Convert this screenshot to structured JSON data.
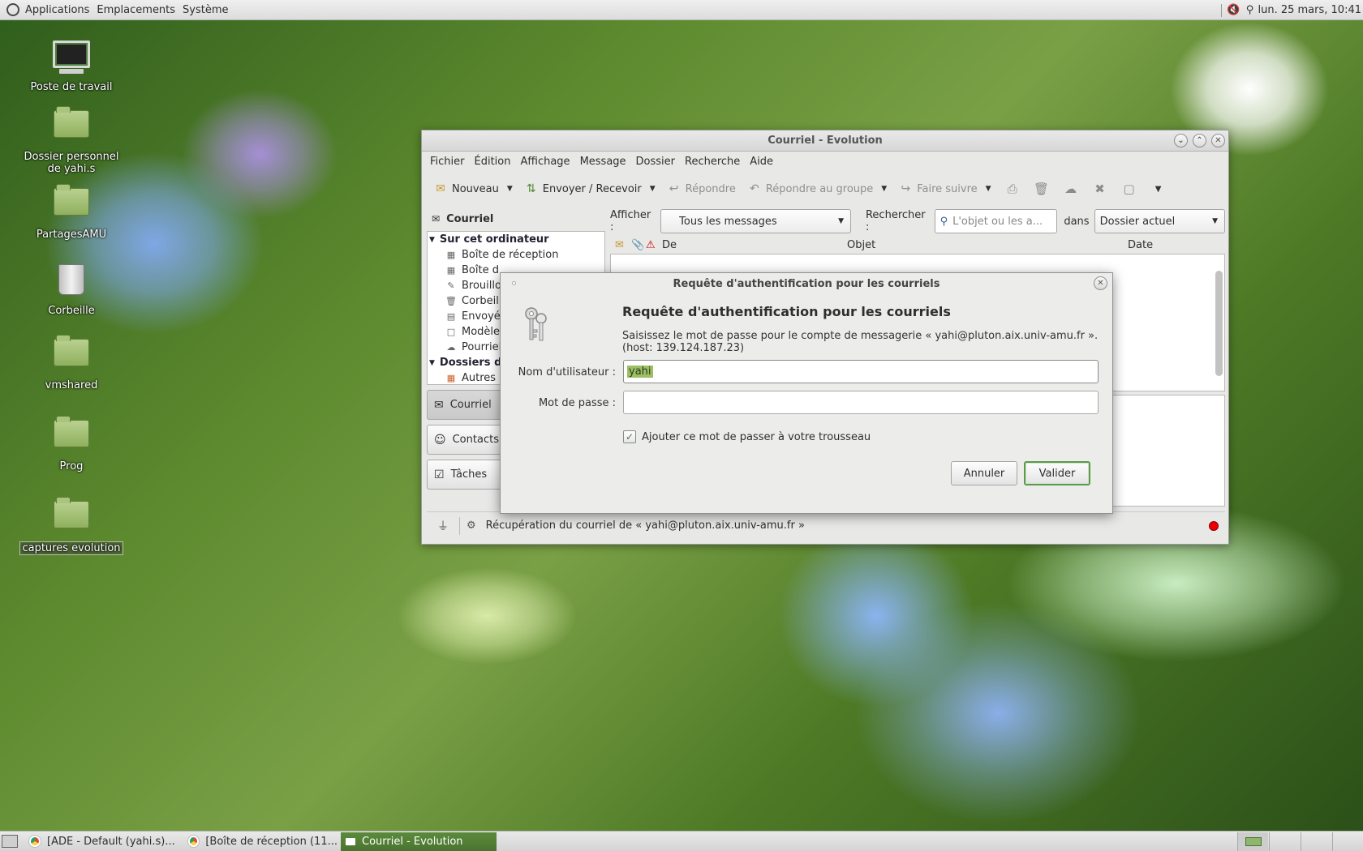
{
  "top_panel": {
    "menus": [
      "Applications",
      "Emplacements",
      "Système"
    ],
    "clock": "lun. 25 mars, 10:41"
  },
  "desktop_icons": [
    {
      "label": "Poste de travail",
      "icon": "computer-icon"
    },
    {
      "label": "Dossier personnel de yahi.s",
      "icon": "home-folder-icon"
    },
    {
      "label": "PartagesAMU",
      "icon": "folder-link-icon"
    },
    {
      "label": "Corbeille",
      "icon": "trash-icon"
    },
    {
      "label": "vmshared",
      "icon": "folder-icon"
    },
    {
      "label": "Prog",
      "icon": "folder-icon"
    },
    {
      "label": "captures evolution",
      "icon": "folder-icon"
    }
  ],
  "evolution": {
    "title": "Courriel - Evolution",
    "menus": [
      "Fichier",
      "Édition",
      "Affichage",
      "Message",
      "Dossier",
      "Recherche",
      "Aide"
    ],
    "toolbar": {
      "new": "Nouveau",
      "send_receive": "Envoyer / Recevoir",
      "reply": "Répondre",
      "reply_group": "Répondre au groupe",
      "forward": "Faire suivre"
    },
    "sidebar_header": "Courriel",
    "folders": {
      "group_local": "Sur cet ordinateur",
      "items": [
        "Boîte de réception",
        "Boîte d",
        "Brouillo",
        "Corbeill",
        "Envoyé",
        "Modèle",
        "Pourriel"
      ],
      "group_search": "Dossiers d",
      "search_items": [
        "Autres c"
      ]
    },
    "switcher": [
      "Courriel",
      "Contacts",
      "Tâches"
    ],
    "filter": {
      "show_label": "Afficher :",
      "show_value": "Tous les messages",
      "search_label": "Rechercher :",
      "search_placeholder": "L'objet ou les a...",
      "in_label": "dans",
      "scope_value": "Dossier actuel"
    },
    "columns": [
      "De",
      "Objet",
      "Date"
    ],
    "status": "Récupération du courriel de « yahi@pluton.aix.univ-amu.fr »"
  },
  "auth_dialog": {
    "title": "Requête d'authentification pour les courriels",
    "heading": "Requête d'authentification pour les courriels",
    "message_line1": "Saisissez le mot de passe pour le compte de messagerie « yahi@pluton.aix.univ-amu.fr ».",
    "message_line2": "(host: 139.124.187.23)",
    "username_label": "Nom d'utilisateur :",
    "username_value": "yahi",
    "password_label": "Mot de passe :",
    "password_value": "",
    "remember_label": "Ajouter ce mot de passer à votre trousseau",
    "remember_checked": true,
    "cancel_label": "Annuler",
    "ok_label": "Valider"
  },
  "taskbar": {
    "tasks": [
      "[ADE - Default (yahi.s)...",
      "[Boîte de réception (11...",
      "Courriel - Evolution"
    ]
  }
}
